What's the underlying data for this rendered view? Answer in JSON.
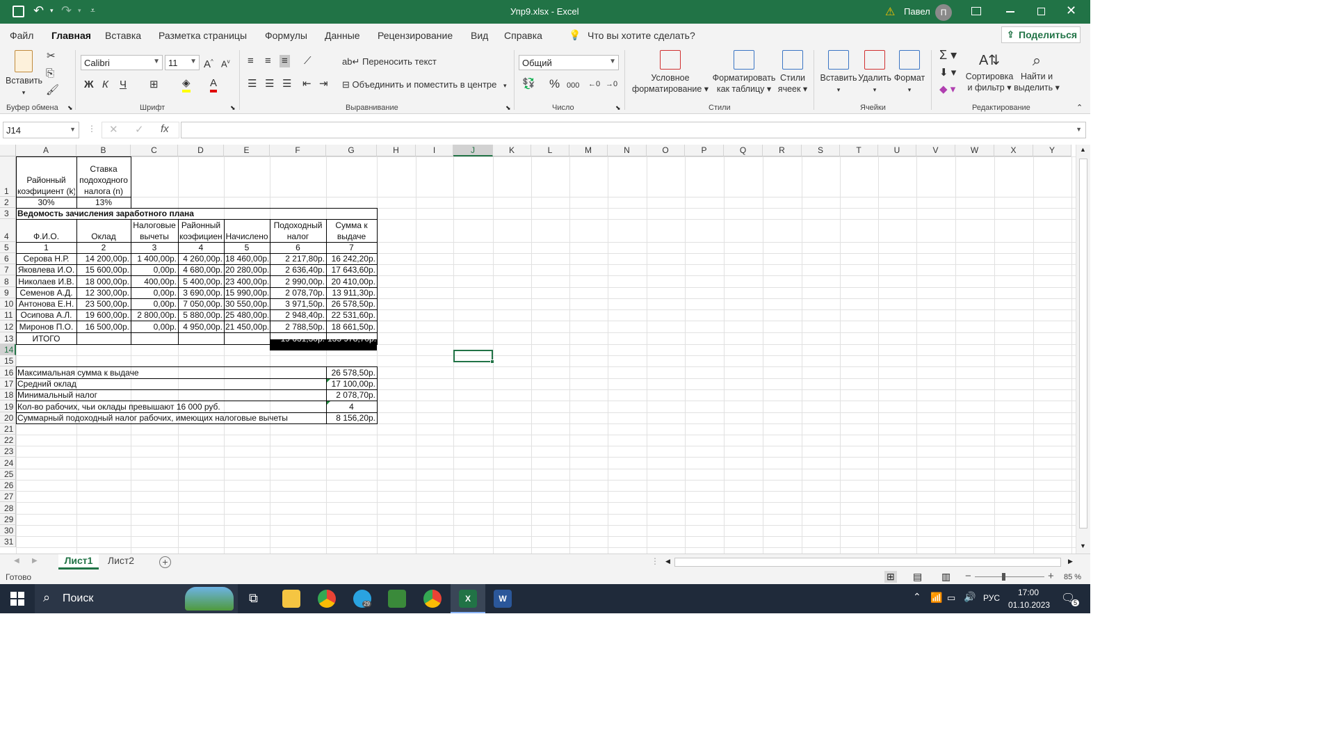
{
  "titlebar": {
    "title": "Упр9.xlsx  -  Excel",
    "user": "Павел",
    "avatar": "П"
  },
  "ribbon_tabs": [
    "Файл",
    "Главная",
    "Вставка",
    "Разметка страницы",
    "Формулы",
    "Данные",
    "Рецензирование",
    "Вид",
    "Справка"
  ],
  "tell_me": "Что вы хотите сделать?",
  "share": "Поделиться",
  "ribbon": {
    "paste": "Вставить",
    "font_name": "Calibri",
    "font_size": "11",
    "wrap_text": "Переносить текст",
    "merge": "Объединить и поместить в центре",
    "number_format": "Общий",
    "cond_format": [
      "Условное",
      "форматирование"
    ],
    "format_table": [
      "Форматировать",
      "как таблицу"
    ],
    "cell_styles": [
      "Стили",
      "ячеек"
    ],
    "insert": "Вставить",
    "delete": "Удалить",
    "format": "Формат",
    "sort": [
      "Сортировка",
      "и фильтр"
    ],
    "find": [
      "Найти и",
      "выделить"
    ],
    "groups": {
      "clipboard": "Буфер обмена",
      "font": "Шрифт",
      "align": "Выравнивание",
      "number": "Число",
      "styles": "Стили",
      "cells": "Ячейки",
      "editing": "Редактирование"
    }
  },
  "formula_bar": {
    "namebox": "J14",
    "fx": "fx",
    "value": ""
  },
  "columns": [
    "A",
    "B",
    "C",
    "D",
    "E",
    "F",
    "G",
    "H",
    "I",
    "J",
    "K",
    "L",
    "M",
    "N",
    "O",
    "P",
    "Q",
    "R",
    "S",
    "T",
    "U",
    "V",
    "W",
    "X",
    "Y"
  ],
  "rows": [
    "1",
    "2",
    "3",
    "4",
    "5",
    "6",
    "7",
    "8",
    "9",
    "10",
    "11",
    "12",
    "13",
    "14",
    "15",
    "16",
    "17",
    "18",
    "19",
    "20",
    "21",
    "22",
    "23",
    "24",
    "25",
    "26",
    "27",
    "28",
    "29",
    "30",
    "31"
  ],
  "cells": {
    "A1": [
      "Районный",
      "коэфициент (k)"
    ],
    "B1": [
      "Ставка",
      "подоходного",
      "налога (n)"
    ],
    "A2": "30%",
    "B2": "13%",
    "A3": "Ведомость зачисления заработного плана",
    "headers4": {
      "A": [
        "Ф.И.О."
      ],
      "B": [
        "Оклад"
      ],
      "C": [
        "Налоговые",
        "вычеты"
      ],
      "D": [
        "Районный",
        "коэфициент"
      ],
      "E": [
        "Начислено"
      ],
      "F": [
        "Подоходный",
        "налог"
      ],
      "G": [
        "Сумма к",
        "выдаче"
      ]
    },
    "row5": [
      "1",
      "2",
      "3",
      "4",
      "5",
      "6",
      "7"
    ],
    "data": [
      [
        "Серова Н.Р.",
        "14 200,00р.",
        "1 400,00р.",
        "4 260,00р.",
        "18 460,00р.",
        "2 217,80р.",
        "16 242,20р."
      ],
      [
        "Яковлева И.О.",
        "15 600,00р.",
        "0,00р.",
        "4 680,00р.",
        "20 280,00р.",
        "2 636,40р.",
        "17 643,60р."
      ],
      [
        "Николаев И.В.",
        "18 000,00р.",
        "400,00р.",
        "5 400,00р.",
        "23 400,00р.",
        "2 990,00р.",
        "20 410,00р."
      ],
      [
        "Семенов А.Д.",
        "12 300,00р.",
        "0,00р.",
        "3 690,00р.",
        "15 990,00р.",
        "2 078,70р.",
        "13 911,30р."
      ],
      [
        "Антонова Е.Н.",
        "23 500,00р.",
        "0,00р.",
        "7 050,00р.",
        "30 550,00р.",
        "3 971,50р.",
        "26 578,50р."
      ],
      [
        "Осипова А.Л.",
        "19 600,00р.",
        "2 800,00р.",
        "5 880,00р.",
        "25 480,00р.",
        "2 948,40р.",
        "22 531,60р."
      ],
      [
        "Миронов П.О.",
        "16 500,00р.",
        "0,00р.",
        "4 950,00р.",
        "21 450,00р.",
        "2 788,50р.",
        "18 661,50р."
      ]
    ],
    "total": {
      "label": "ИТОГО",
      "F": "19 631,30р.",
      "G": "135 978,70р."
    },
    "summary": [
      {
        "label": "Максимальная сумма к выдаче",
        "value": "26 578,50р."
      },
      {
        "label": "Средний оклад",
        "value": "17 100,00р."
      },
      {
        "label": "Минимальный налог",
        "value": "2 078,70р."
      },
      {
        "label": "Кол-во рабочих, чьи оклады превышают 16 000 руб.",
        "value": "4"
      },
      {
        "label": "Суммарный подоходный налог рабочих, имеющих налоговые вычеты",
        "value": "8 156,20р."
      }
    ]
  },
  "sheets": [
    "Лист1",
    "Лист2"
  ],
  "status": {
    "ready": "Готово",
    "zoom": "85 %"
  },
  "taskbar": {
    "search": "Поиск",
    "lang": "РУС",
    "time": "17:00",
    "date": "01.10.2023",
    "telegram_badge": "29",
    "notif": "5"
  },
  "colors": {
    "excel_green": "#217346",
    "taskbar": "#1f2a3a",
    "selected_cell": "#217346"
  }
}
